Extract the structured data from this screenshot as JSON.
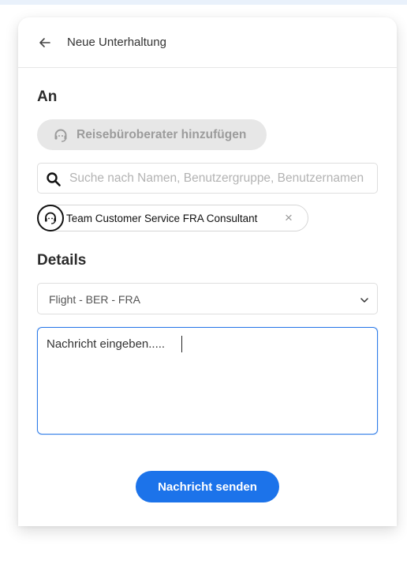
{
  "header": {
    "title": "Neue Unterhaltung"
  },
  "recipients": {
    "section_title": "An",
    "add_button_label": "Reisebüroberater hinzufügen",
    "search_placeholder": "Suche nach Namen, Benutzergruppe, Benutzernamen",
    "selected": [
      {
        "label": "Team Customer Service FRA Consultant",
        "remove_label": "×"
      }
    ]
  },
  "details": {
    "section_title": "Details",
    "trip_select_value": "Flight - BER - FRA",
    "message_value": "Nachricht eingeben....."
  },
  "actions": {
    "send_label": "Nachricht senden"
  },
  "colors": {
    "accent": "#1c73ea",
    "focus_border": "#2f7ce8",
    "pill_background": "#e7e7e7"
  }
}
